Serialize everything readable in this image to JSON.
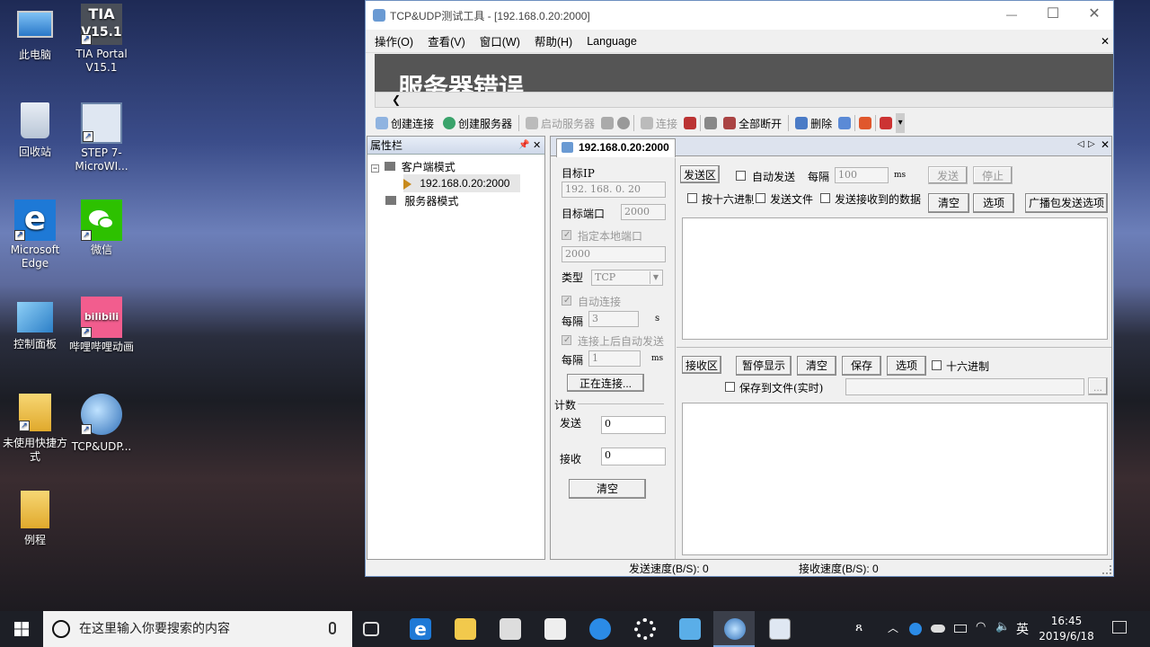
{
  "desktop": {
    "icons": [
      {
        "label": "此电脑",
        "icon": "computer-icon"
      },
      {
        "label": "TIA Portal V15.1",
        "icon": "tia-portal-icon"
      },
      {
        "label": "回收站",
        "icon": "recycle-bin-icon"
      },
      {
        "label": "STEP 7-MicroWI...",
        "icon": "step7-icon"
      },
      {
        "label": "Microsoft Edge",
        "icon": "edge-icon"
      },
      {
        "label": "微信",
        "icon": "wechat-icon"
      },
      {
        "label": "控制面板",
        "icon": "control-panel-icon"
      },
      {
        "label": "哔哩哔哩动画",
        "icon": "bilibili-icon"
      },
      {
        "label": "未使用快捷方式",
        "icon": "folder-icon"
      },
      {
        "label": "TCP&UDP...",
        "icon": "tcp-udp-icon"
      },
      {
        "label": "例程",
        "icon": "folder-icon"
      }
    ],
    "tia_badge": "TIA",
    "tia_version": "V15.1",
    "bilibili_text": "bilibili"
  },
  "window": {
    "title": "TCP&UDP测试工具 - [192.168.0.20:2000]",
    "minimize": "—",
    "maximize": "☐",
    "close": "✕",
    "menu": [
      "操作(O)",
      "查看(V)",
      "窗口(W)",
      "帮助(H)",
      "Language"
    ],
    "menu_close": "✕",
    "banner_text": "服务器错误",
    "scroll_left": "❮",
    "toolbar": [
      {
        "label": "创建连接",
        "enabled": true
      },
      {
        "label": "创建服务器",
        "enabled": true
      },
      {
        "label": "启动服务器",
        "enabled": false
      },
      {
        "label": "连接",
        "enabled": false
      },
      {
        "label": "全部断开",
        "enabled": true
      },
      {
        "label": "删除",
        "enabled": true
      }
    ],
    "toolbar_more": "▾"
  },
  "properties": {
    "title": "属性栏",
    "pin": "📌",
    "close": "✕",
    "tree": {
      "client_mode": "客户端模式",
      "connection": "192.168.0.20:2000",
      "server_mode": "服务器模式",
      "expand": "−"
    }
  },
  "tab": {
    "label": "192.168.0.20:2000",
    "nav_prev": "◁",
    "nav_next": "▷",
    "close": "✕"
  },
  "conn": {
    "target_ip_label": "目标IP",
    "target_ip": "192. 168. 0. 20",
    "target_port_label": "目标端口",
    "target_port": "2000",
    "local_port_label": "指定本地端口",
    "local_port": "2000",
    "type_label": "类型",
    "type": "TCP",
    "auto_connect_label": "自动连接",
    "interval_label": "每隔",
    "interval1": "3",
    "unit_s": "s",
    "auto_send_label": "连接上后自动发送",
    "interval2": "1",
    "unit_ms": "ms",
    "connecting_button": "正在连接...",
    "count_label": "计数",
    "send_count_label": "发送",
    "send_count": "0",
    "recv_count_label": "接收",
    "recv_count": "0",
    "clear_button": "清空"
  },
  "send": {
    "section": "发送区",
    "auto_send": "自动发送",
    "interval_label": "每隔",
    "interval": "100",
    "unit": "ms",
    "send_button": "发送",
    "stop_button": "停止",
    "hex": "按十六进制",
    "send_file": "发送文件",
    "send_received": "发送接收到的数据",
    "clear": "清空",
    "options": "选项",
    "broadcast": "广播包发送选项"
  },
  "recv": {
    "section": "接收区",
    "pause": "暂停显示",
    "clear": "清空",
    "save": "保存",
    "options": "选项",
    "hex": "十六进制",
    "save_file": "保存到文件(实时)",
    "browse": "..."
  },
  "status": {
    "send_speed": "发送速度(B/S): 0",
    "recv_speed": "接收速度(B/S): 0"
  },
  "taskbar": {
    "search_placeholder": "在这里输入你要搜索的内容",
    "time": "16:45",
    "date": "2019/6/18",
    "ime": "英"
  }
}
